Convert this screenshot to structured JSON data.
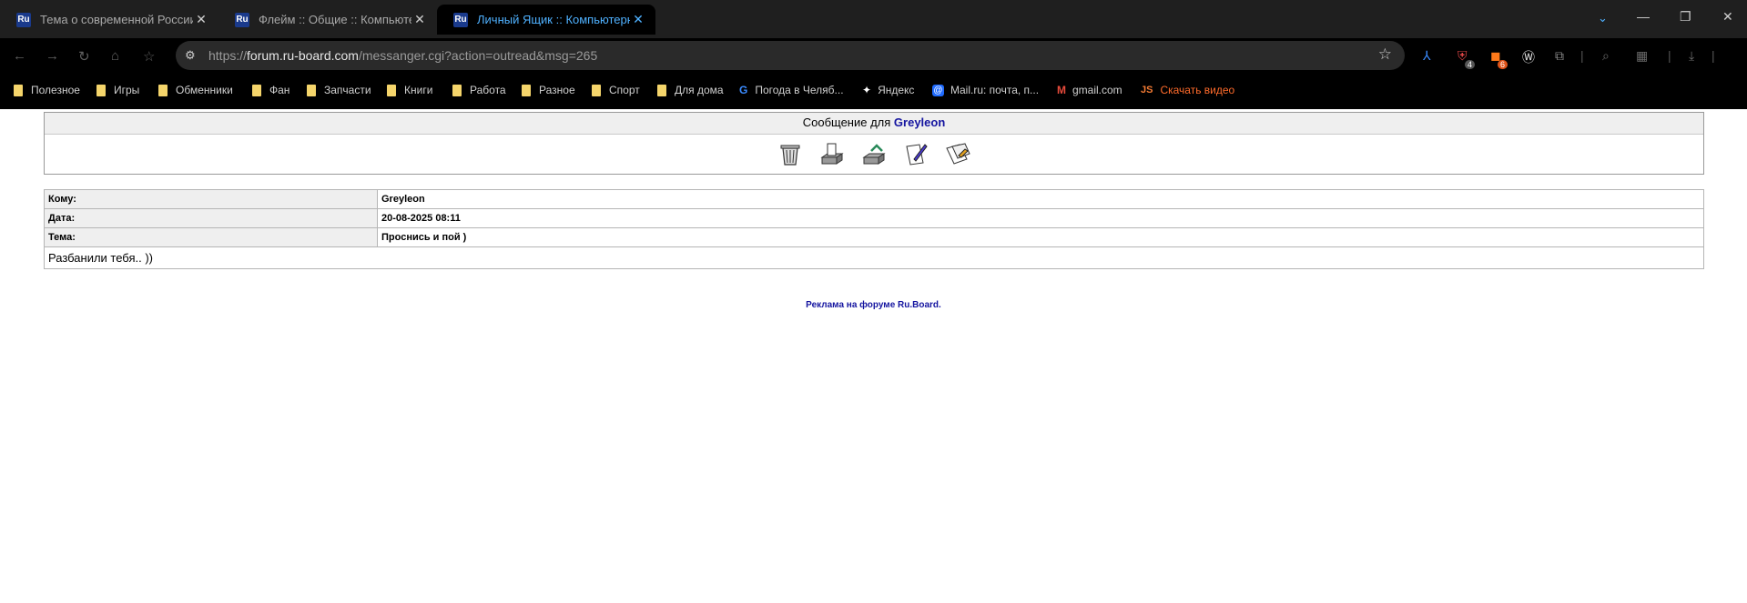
{
  "browser": {
    "tabs": [
      {
        "label": "Тема о современной России - ",
        "active": false
      },
      {
        "label": "Флейм :: Общие :: Компьютерн",
        "active": false
      },
      {
        "label": "Личный Ящик :: Компьютерны",
        "active": true
      }
    ],
    "favicon_text": "Ru",
    "url_prefix": "https://",
    "url_host": "forum.ru-board.com",
    "url_path": "/messanger.cgi?action=outread&msg=265",
    "extensions": {
      "badge1": "4",
      "badge2": "6"
    },
    "bookmarks": [
      {
        "label": "Полезное",
        "kind": "folder"
      },
      {
        "label": "Игры",
        "kind": "folder"
      },
      {
        "label": "Обменники",
        "kind": "folder"
      },
      {
        "label": "Фан",
        "kind": "folder"
      },
      {
        "label": "Запчасти",
        "kind": "folder"
      },
      {
        "label": "Книги",
        "kind": "folder"
      },
      {
        "label": "Работа",
        "kind": "folder"
      },
      {
        "label": "Разное",
        "kind": "folder"
      },
      {
        "label": "Спорт",
        "kind": "folder"
      },
      {
        "label": "Для дома",
        "kind": "folder"
      },
      {
        "label": "Погода в Челяб...",
        "kind": "google"
      },
      {
        "label": "Яндекс",
        "kind": "sparkle"
      },
      {
        "label": "Mail.ru: почта, п...",
        "kind": "mail"
      },
      {
        "label": "gmail.com",
        "kind": "gmail"
      },
      {
        "label": "Скачать видео",
        "kind": "js"
      }
    ]
  },
  "message": {
    "header_prefix": "Сообщение для",
    "header_user": "Greyleon",
    "to_label": "Кому:",
    "to_value": "Greyleon",
    "date_label": "Дата:",
    "date_value": "20-08-2025 08:11",
    "subject_label": "Тема:",
    "subject_value": "Проснись и пой )",
    "body": "Разбанили тебя.. ))"
  },
  "footer": {
    "ad_link": "Реклама на форуме Ru.Board."
  },
  "colors": {
    "link_blue": "#1515a0",
    "active_tab_text": "#4fb1ff"
  }
}
